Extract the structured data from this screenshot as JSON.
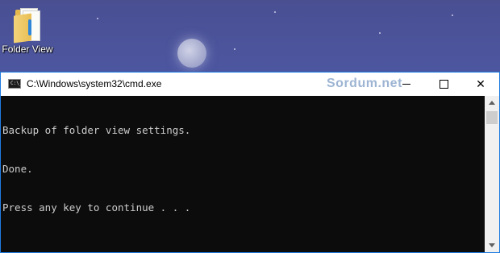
{
  "desktop": {
    "icons": [
      {
        "label": "Folder View",
        "icon": "folder-icon"
      }
    ]
  },
  "window": {
    "title": "C:\\Windows\\system32\\cmd.exe",
    "app_icon": "cmd-icon",
    "app_icon_text": "C:\\_",
    "watermark": "Sordum.net",
    "controls": {
      "minimize": "minimize-icon",
      "maximize": "maximize-icon",
      "close": "close-icon",
      "close_glyph": "✕"
    }
  },
  "console": {
    "lines": [
      "Backup of folder view settings.",
      "Done.",
      "Press any key to continue . . ."
    ]
  },
  "colors": {
    "console_bg": "#0c0c0c",
    "console_text": "#cccccc",
    "titlebar_bg": "#ffffff",
    "window_border": "#1e7be0"
  }
}
